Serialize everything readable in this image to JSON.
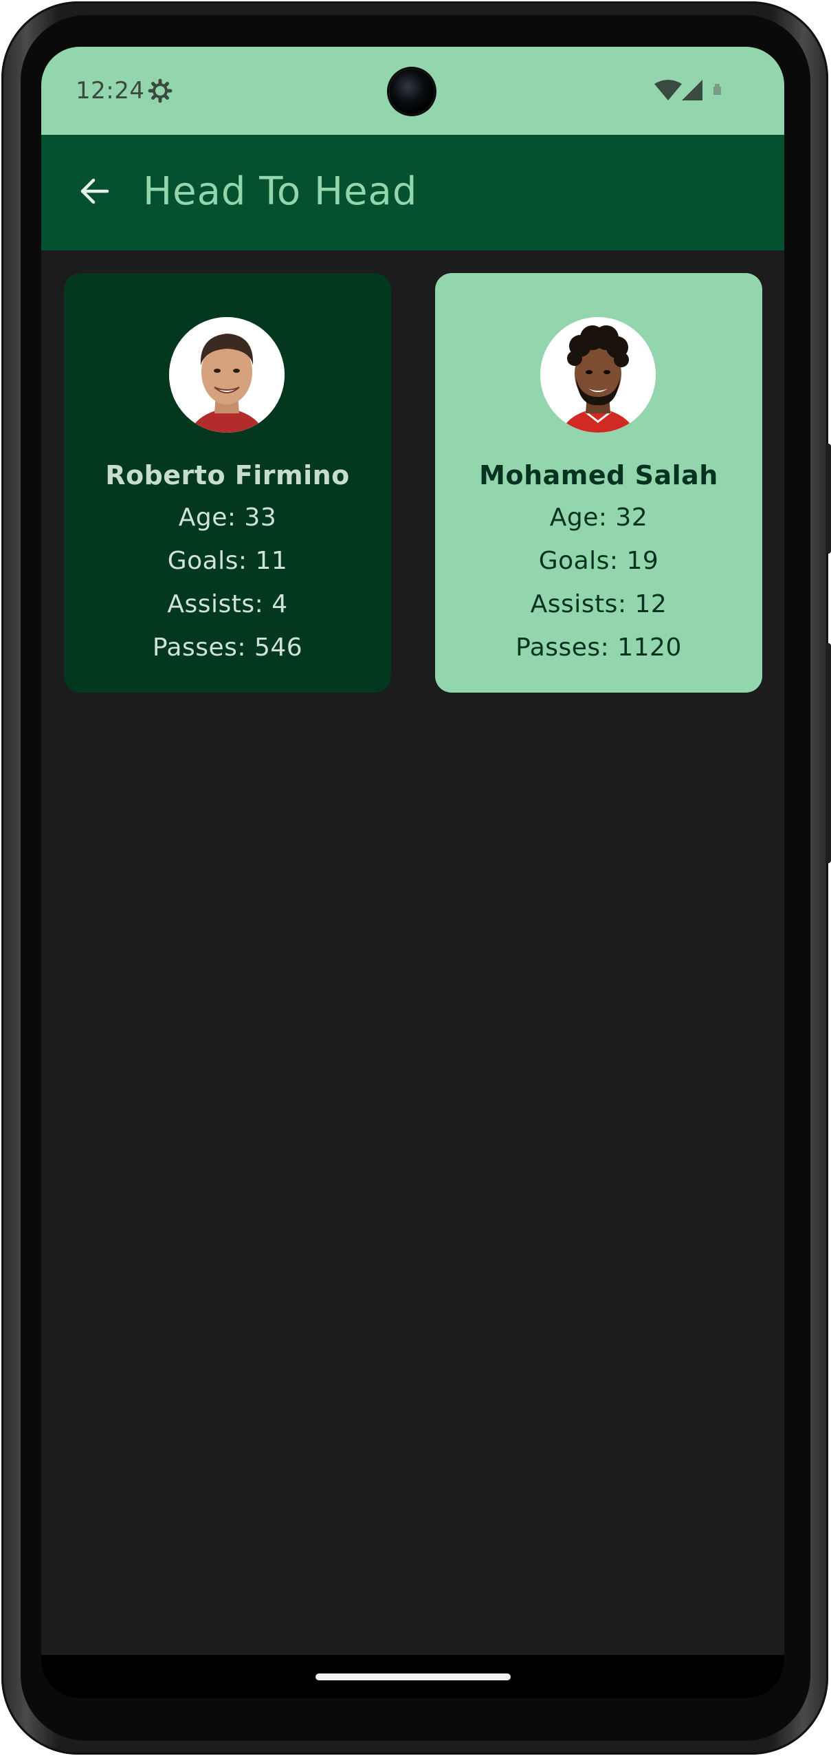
{
  "status_bar": {
    "time": "12:24",
    "settings_icon": "gear-icon",
    "wifi_icon": "wifi-icon",
    "signal_icon": "cell-signal-icon",
    "battery_icon": "battery-icon"
  },
  "app_bar": {
    "title": "Head To Head",
    "back_icon": "arrow-back-icon"
  },
  "players": [
    {
      "name": "Roberto Firmino",
      "age": "Age: 33",
      "goals": "Goals: 11",
      "assists": "Assists: 4",
      "passes": "Passes: 546",
      "avatar": "player-photo"
    },
    {
      "name": "Mohamed Salah",
      "age": "Age: 32",
      "goals": "Goals: 19",
      "assists": "Assists: 12",
      "passes": "Passes: 1120",
      "avatar": "player-photo"
    }
  ],
  "colors": {
    "status_bar": "#93d5ad",
    "app_bar": "#05502e",
    "background": "#1b1c1b",
    "card_dark": "#03381e",
    "card_light": "#93d5ad"
  }
}
